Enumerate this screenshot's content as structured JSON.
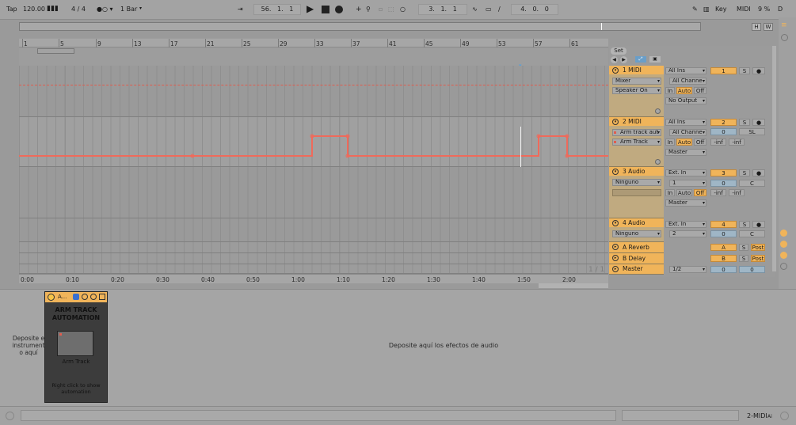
{
  "transport": {
    "tap": "Tap",
    "tempo": "120.00",
    "sig": "4 / 4",
    "quant": "1 Bar",
    "pos": "56.   1.   1",
    "loop_start": "3.   1.   1",
    "loop_len": "4.   0.   0",
    "key": "Key",
    "midi": "MIDI",
    "cpu": "9 %",
    "d": "D"
  },
  "overview": {
    "h": "H",
    "w": "W"
  },
  "ruler_bars": [
    "1",
    "5",
    "9",
    "13",
    "17",
    "21",
    "25",
    "29",
    "33",
    "37",
    "41",
    "45",
    "49",
    "53",
    "57",
    "61"
  ],
  "time_ruler": [
    "0:00",
    "0:10",
    "0:20",
    "0:30",
    "0:40",
    "0:50",
    "1:00",
    "1:10",
    "1:20",
    "1:30",
    "1:40",
    "1:50",
    "2:00"
  ],
  "set_label": "Set",
  "tracks": [
    {
      "name": "1 MIDI",
      "input": "All Ins",
      "ch": "All Channe",
      "d1": "Mixer",
      "d2": "Speaker On",
      "mon_in": "In",
      "mon_auto": "Auto",
      "mon_off": "Off",
      "out": "No Output",
      "num": "1",
      "s": "S"
    },
    {
      "name": "2 MIDI",
      "input": "All Ins",
      "ch": "All Channe",
      "d1": "Arm track aut",
      "d2": "Arm Track",
      "mon_in": "In",
      "mon_auto": "Auto",
      "mon_off": "Off",
      "out": "Master",
      "num": "2",
      "s": "S",
      "vol": "0",
      "pan": "SL",
      "inf1": "-inf",
      "inf2": "-inf"
    },
    {
      "name": "3 Audio",
      "input": "Ext. In",
      "ch": "1",
      "d1": "Ninguno",
      "mon_in": "In",
      "mon_auto": "Auto",
      "mon_off": "Off",
      "out": "Master",
      "num": "3",
      "s": "S",
      "vol": "0",
      "pan": "C",
      "inf1": "-inf",
      "inf2": "-inf"
    },
    {
      "name": "4 Audio",
      "input": "Ext. In",
      "ch": "2",
      "d1": "Ninguno",
      "num": "4",
      "s": "S",
      "vol": "0",
      "pan": "C"
    }
  ],
  "returns": [
    {
      "name": "A Reverb",
      "letter": "A",
      "s": "S",
      "post": "Post"
    },
    {
      "name": "B Delay",
      "letter": "B",
      "s": "S",
      "post": "Post"
    }
  ],
  "master": {
    "name": "Master",
    "out": "1/2",
    "vol": "0",
    "pan": "0"
  },
  "page_indicator": "1 / 1",
  "device": {
    "drop_instrument": "Deposite e instrument o aquí",
    "drop_effects": "Deposite aquí los efectos de audio",
    "rack_short": "A...",
    "rack_title": "ARM TRACK AUTOMATION",
    "macro_label": "Arm Track",
    "hint": "Right click to show automation"
  },
  "status": {
    "track": "2-MIDI",
    "ai": "Ai"
  }
}
